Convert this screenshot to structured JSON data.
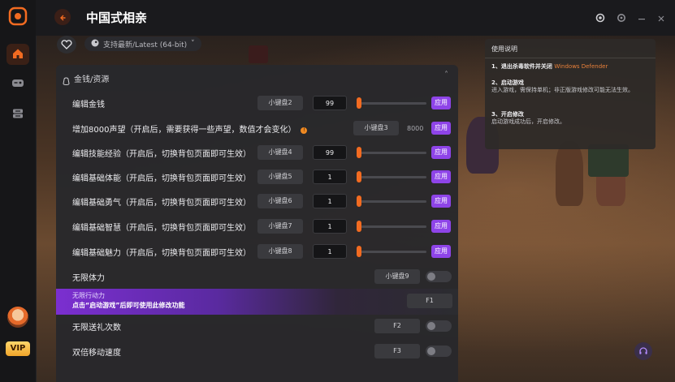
{
  "app": {
    "title": "中国式相亲"
  },
  "launch": {
    "platform_label": "支持最新/Latest (64-bit)",
    "dropdown_arrow": "˅"
  },
  "info_box": {
    "heading": "使用说明",
    "step1_title": "1、退出杀毒软件并关闭",
    "step1_highlight": "Windows Defender",
    "step2_title": "2、启动游戏",
    "step2_text": "进入游戏，需保持单机；非正版游戏修改可能无法生效。",
    "step3_title": "3、开启修改",
    "step3_text": "启动游戏成功后，开启修改。"
  },
  "panel": {
    "section_title": "金钱/资源",
    "collapse_glyph": "˄",
    "apply_label": "应用",
    "rows": [
      {
        "label": "编辑金钱",
        "hotkey": "小键盘2",
        "value": "99",
        "level": 0
      },
      {
        "label": "增加8000声望（开启后，需要获得一些声望，数值才会变化）",
        "hotkey": "小键盘3",
        "value": "8000",
        "warn": "!"
      },
      {
        "label": "编辑技能经验（开启后，切换背包页面即可生效）",
        "hotkey": "小键盘4",
        "value": "99",
        "level": 0
      },
      {
        "label": "编辑基础体能（开启后，切换背包页面即可生效）",
        "hotkey": "小键盘5",
        "value": "1",
        "level": 0
      },
      {
        "label": "编辑基础勇气（开启后，切换背包页面即可生效）",
        "hotkey": "小键盘6",
        "value": "1",
        "level": 0
      },
      {
        "label": "编辑基础智慧（开启后，切换背包页面即可生效）",
        "hotkey": "小键盘7",
        "value": "1",
        "level": 0
      },
      {
        "label": "编辑基础魅力（开启后，切换背包页面即可生效）",
        "hotkey": "小键盘8",
        "value": "1",
        "level": 0
      },
      {
        "label": "无限体力",
        "hotkey": "小键盘9",
        "toggle_on": false
      }
    ],
    "promo": {
      "title": "无限行动力",
      "hint": "点击“启动游戏”后即可使用此修改功能",
      "hotkey": "F1"
    },
    "rows_after": [
      {
        "label": "无限送礼次数",
        "hotkey": "F2",
        "toggle_on": false
      },
      {
        "label": "双倍移动速度",
        "hotkey": "F3",
        "toggle_on": false
      }
    ]
  },
  "sidebar": {
    "vip_label": "VIP"
  },
  "colors": {
    "accent_orange": "#f26b21",
    "accent_purple": "#8e44e8"
  },
  "icons": [
    "app-logo-icon",
    "home-icon",
    "gamepad-icon",
    "storage-icon",
    "heart-icon",
    "steam-icon",
    "back-arrow-icon",
    "record-icon",
    "settings-icon",
    "minimize-icon",
    "close-icon",
    "headset-icon"
  ]
}
